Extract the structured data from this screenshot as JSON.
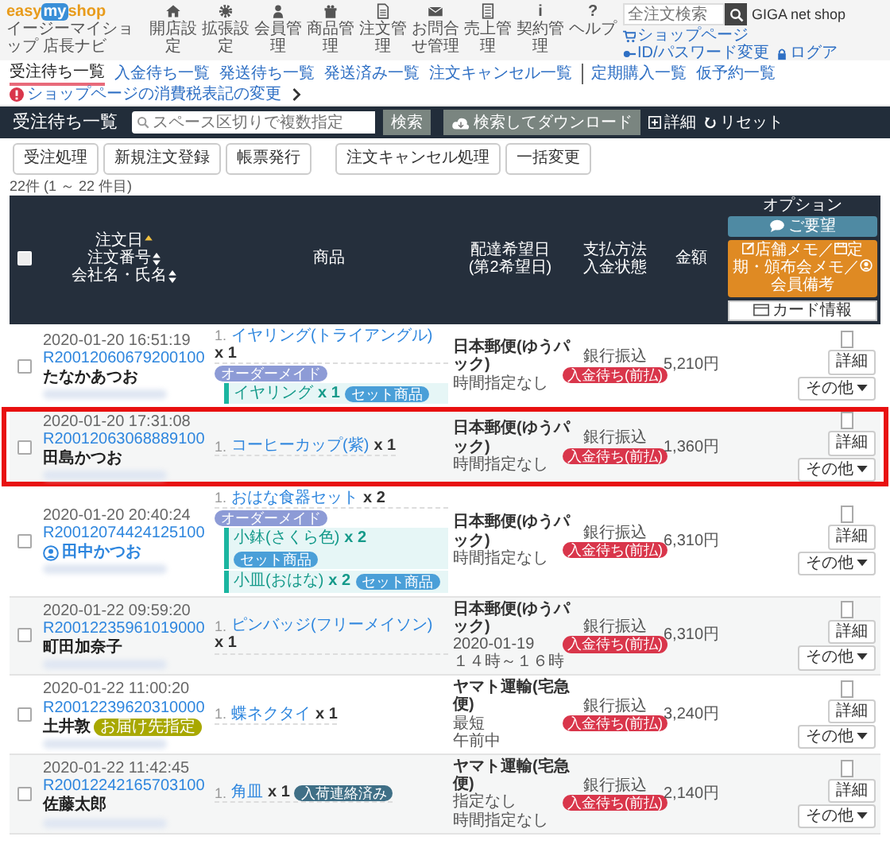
{
  "logo": {
    "parts": [
      "easy",
      "my",
      "shop"
    ],
    "subtitle": "イージーマイショップ 店長ナビ"
  },
  "nav": [
    {
      "label": "開店設定"
    },
    {
      "label": "拡張設定"
    },
    {
      "label": "会員管理"
    },
    {
      "label": "商品管理"
    },
    {
      "label": "注文管理"
    },
    {
      "label": "お問合せ管理"
    },
    {
      "label": "売上管理"
    },
    {
      "label": "契約管理",
      "glyph": "i"
    },
    {
      "label": "ヘルプ",
      "glyph": "?"
    }
  ],
  "global_search": {
    "placeholder": "全注文検索"
  },
  "account": "GIGA net shop",
  "links": [
    "ショップページ",
    "ID/パスワード変更",
    "ログア"
  ],
  "subnav": [
    {
      "label": "受注待ち一覧",
      "selected": true
    },
    {
      "label": "入金待ち一覧",
      "selected": false
    },
    {
      "label": "発送待ち一覧",
      "selected": false
    },
    {
      "label": "発送済み一覧",
      "selected": false
    },
    {
      "label": "注文キャンセル一覧",
      "selected": false
    },
    {
      "label": "定期購入一覧",
      "selected": false
    },
    {
      "label": "仮予約一覧",
      "selected": false
    }
  ],
  "notice": "ショップページの消費税表記の変更",
  "toolbar": {
    "title": "受注待ち一覧",
    "placeholder": "スペース区切りで複数指定",
    "search": "検索",
    "download": "検索してダウンロード",
    "detail": "詳細",
    "reset": "リセット"
  },
  "actions": [
    "受注処理",
    "新規注文登録",
    "帳票発行",
    "注文キャンセル処理",
    "一括変更"
  ],
  "count": "22件 (1 ～ 22 件目)",
  "select_all": {
    "checked": false
  },
  "columns": {
    "order": [
      {
        "label": "注文日",
        "sorted": true
      },
      {
        "label": "注文番号",
        "sorted": false
      },
      {
        "label": "会社名・氏名",
        "sorted": false
      }
    ],
    "product": "商品",
    "delivery": [
      "配達希望日",
      "(第2希望日)"
    ],
    "payment": [
      "支払方法",
      "入金状態"
    ],
    "amount": "金額",
    "option": {
      "title": "オプション",
      "request": "ご要望",
      "memo": [
        "店舗メモ／",
        "定期・頒布会メモ／",
        "会員備考"
      ],
      "card": "カード情報"
    }
  },
  "rows": [
    {
      "checked": false,
      "highlighted": false,
      "date": "2020-01-20 16:51:19",
      "order_no": "R20012060679200100",
      "name": "たなかあつお",
      "member": false,
      "items": [
        {
          "no": "1.",
          "name": "イヤリング(トライアングル)",
          "qty": "x 1",
          "tags": [
            {
              "label": "オーダーメイド",
              "color": "#8d9bd6"
            }
          ],
          "children": [
            {
              "name": "イヤリング",
              "qty": "x 1",
              "tag": {
                "label": "セット商品",
                "color": "#4a9fd8"
              }
            }
          ]
        }
      ],
      "carrier": "日本郵便(ゆうパック)",
      "delivery": [
        "時間指定なし"
      ],
      "payment": "銀行振込",
      "status": "入金待ち(前払)",
      "amount": "5,210円",
      "option_checked": false,
      "detail": "詳細",
      "more": "その他"
    },
    {
      "checked": false,
      "highlighted": true,
      "date": "2020-01-20 17:31:08",
      "order_no": "R20012063068889100",
      "name": "田島かつお",
      "member": false,
      "items": [
        {
          "no": "1.",
          "name": "コーヒーカップ(紫)",
          "qty": "x 1"
        }
      ],
      "carrier": "日本郵便(ゆうパック)",
      "delivery": [
        "時間指定なし"
      ],
      "payment": "銀行振込",
      "status": "入金待ち(前払)",
      "amount": "1,360円",
      "option_checked": false,
      "detail": "詳細",
      "more": "その他"
    },
    {
      "checked": false,
      "highlighted": false,
      "date": "2020-01-20 20:40:24",
      "order_no": "R20012074424125100",
      "name": "田中かつお",
      "member": true,
      "items": [
        {
          "no": "1.",
          "name": "おはな食器セット",
          "qty": "x 2",
          "tags": [
            {
              "label": "オーダーメイド",
              "color": "#8d9bd6"
            }
          ],
          "children": [
            {
              "name": "小鉢(さくら色)",
              "qty": "x 2",
              "tag": {
                "label": "セット商品",
                "color": "#4a9fd8"
              }
            },
            {
              "name": "小皿(おはな)",
              "qty": "x 2",
              "tag": {
                "label": "セット商品",
                "color": "#4a9fd8"
              }
            }
          ]
        }
      ],
      "carrier": "日本郵便(ゆうパック)",
      "delivery": [
        "時間指定なし"
      ],
      "payment": "銀行振込",
      "status": "入金待ち(前払)",
      "amount": "6,310円",
      "option_checked": false,
      "detail": "詳細",
      "more": "その他"
    },
    {
      "checked": false,
      "highlighted": false,
      "date": "2020-01-22 09:59:20",
      "order_no": "R20012235961019000",
      "name": "町田加奈子",
      "member": false,
      "items": [
        {
          "no": "1.",
          "name": "ピンバッジ(フリーメイソン)",
          "qty": "x 1"
        }
      ],
      "carrier": "日本郵便(ゆうパック)",
      "delivery": [
        "2020-01-19",
        "１４時～１６時"
      ],
      "payment": "銀行振込",
      "status": "入金待ち(前払)",
      "amount": "6,310円",
      "option_checked": false,
      "detail": "詳細",
      "more": "その他"
    },
    {
      "checked": false,
      "highlighted": false,
      "date": "2020-01-22 11:00:20",
      "order_no": "R20012239620310000",
      "name": "土井敦",
      "member": false,
      "name_tag": {
        "label": "お届け先指定",
        "color": "#a8a800"
      },
      "items": [
        {
          "no": "1.",
          "name": "蝶ネクタイ",
          "qty": "x 1"
        }
      ],
      "carrier": "ヤマト運輸(宅急便)",
      "delivery": [
        "最短",
        "午前中"
      ],
      "payment": "銀行振込",
      "status": "入金待ち(前払)",
      "amount": "3,240円",
      "option_checked": false,
      "detail": "詳細",
      "more": "その他"
    },
    {
      "checked": false,
      "highlighted": false,
      "date": "2020-01-22 11:42:45",
      "order_no": "R20012242165703100",
      "name": "佐藤太郎",
      "member": false,
      "items": [
        {
          "no": "1.",
          "name": "角皿",
          "qty": "x 1",
          "tags": [
            {
              "label": "入荷連絡済み",
              "color": "#3f6f86"
            }
          ]
        }
      ],
      "carrier": "ヤマト運輸(宅急便)",
      "delivery": [
        "指定なし",
        "時間指定なし"
      ],
      "payment": "銀行振込",
      "status": "入金待ち(前払)",
      "amount": "2,140円",
      "option_checked": false,
      "detail": "詳細",
      "more": "その他"
    }
  ]
}
